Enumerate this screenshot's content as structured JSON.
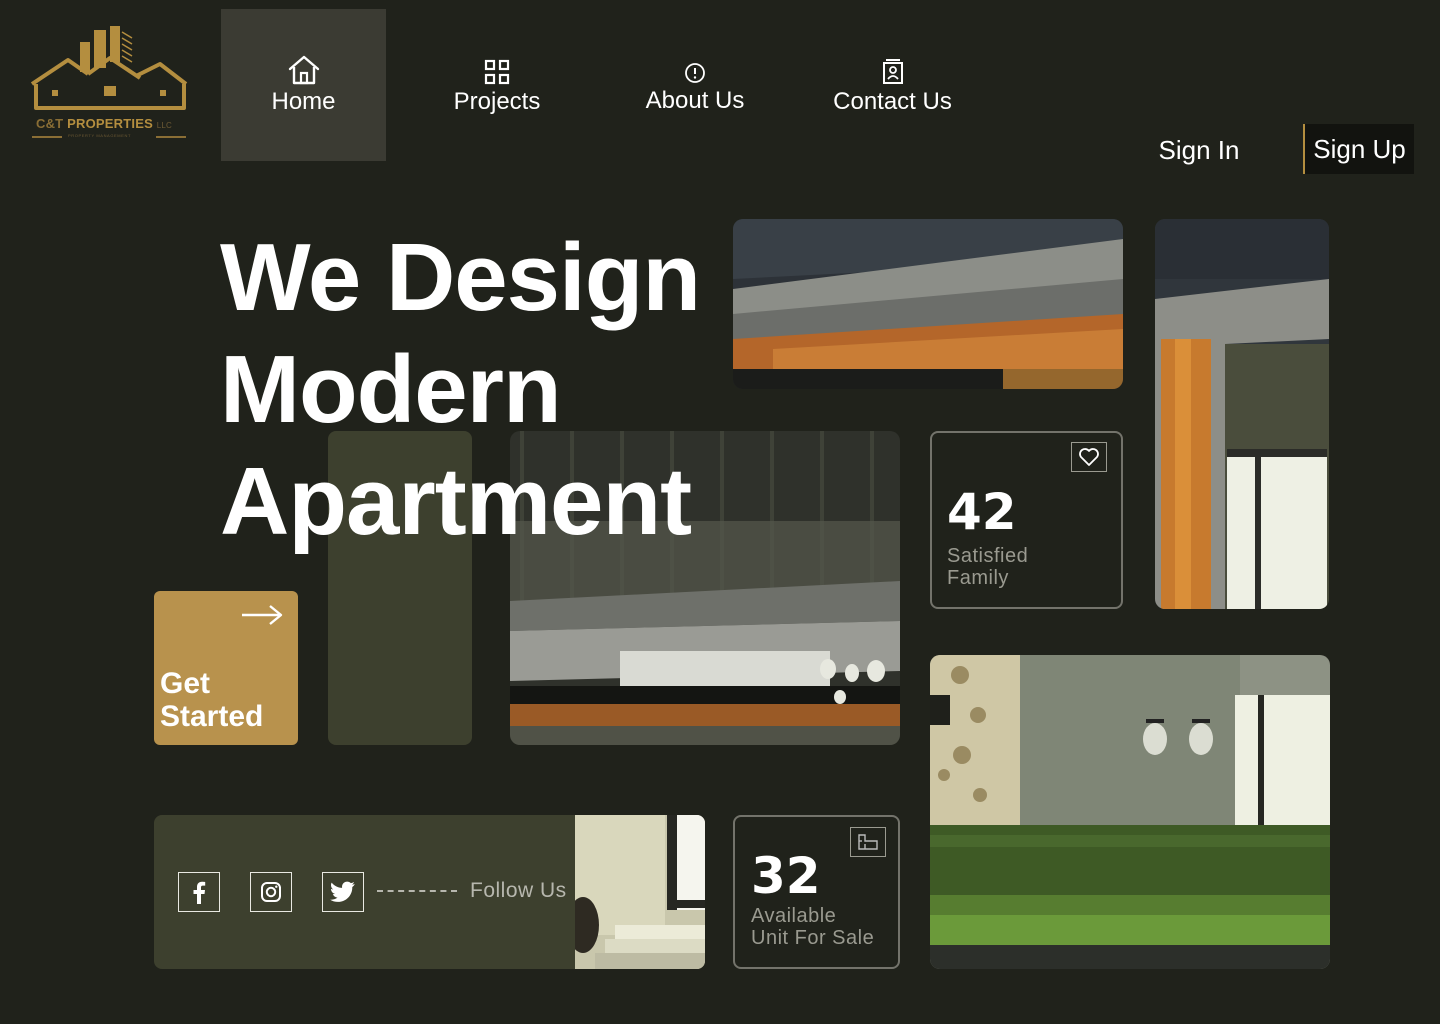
{
  "brand": {
    "name": "PROPERTIES",
    "prefix": "C&T",
    "suffix": "LLC",
    "tagline": "PROPERTY MANAGEMENT",
    "colors": {
      "gold": "#b8924d",
      "background": "#20221b",
      "olive": "#3d402e",
      "nav_active": "#3b3b33"
    }
  },
  "nav": {
    "items": [
      {
        "label": "Home",
        "icon": "home-icon",
        "active": true
      },
      {
        "label": "Projects",
        "icon": "grid-icon",
        "active": false
      },
      {
        "label": "About Us",
        "icon": "info-icon",
        "active": false
      },
      {
        "label": "Contact Us",
        "icon": "contact-card-icon",
        "active": false
      }
    ],
    "sign_in": "Sign In",
    "sign_up": "Sign Up"
  },
  "hero": {
    "headline": [
      "We Design",
      "Modern",
      "Apartment"
    ],
    "cta_label": "Get Started",
    "cta_icon": "arrow-right-icon"
  },
  "stats": [
    {
      "value": "42",
      "caption_line1": "Satisfied",
      "caption_line2": "Family",
      "icon": "heart-icon"
    },
    {
      "value": "32",
      "caption_line1": "Available",
      "caption_line2": "Unit For Sale",
      "icon": "floorplan-icon"
    }
  ],
  "social": {
    "icons": [
      "facebook-icon",
      "instagram-icon",
      "twitter-icon"
    ],
    "follow_label": "Follow Us"
  }
}
